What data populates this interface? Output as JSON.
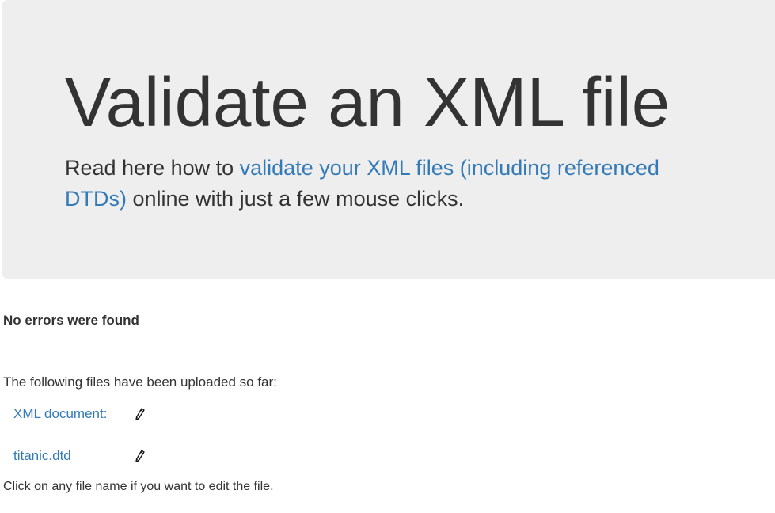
{
  "jumbotron": {
    "title": "Validate an XML file",
    "intro_before": "Read here how to ",
    "intro_link": "validate your XML files (including referenced DTDs)",
    "intro_after": " online with just a few mouse clicks."
  },
  "status": "No errors were found",
  "uploads": {
    "intro": "The following files have been uploaded so far:",
    "files": [
      {
        "label": "XML document:",
        "icon": "pencil-icon"
      },
      {
        "label": "titanic.dtd",
        "icon": "pencil-icon"
      }
    ],
    "hint": "Click on any file name if you want to edit the file."
  },
  "colors": {
    "link": "#337ab7",
    "jumbotron_bg": "#eeeeee",
    "text": "#333333"
  }
}
